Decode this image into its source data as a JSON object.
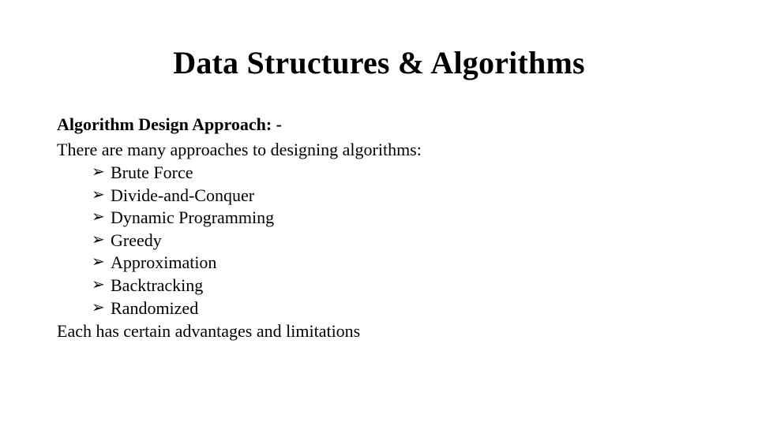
{
  "title": "Data Structures & Algorithms",
  "section_heading": "Algorithm Design Approach: -",
  "intro_line": "There are many approaches to designing algorithms:",
  "bullets": [
    "Brute Force",
    "Divide-and-Conquer",
    "Dynamic Programming",
    "Greedy",
    "Approximation",
    "Backtracking",
    "Randomized"
  ],
  "closing_line": "Each has certain advantages and limitations"
}
